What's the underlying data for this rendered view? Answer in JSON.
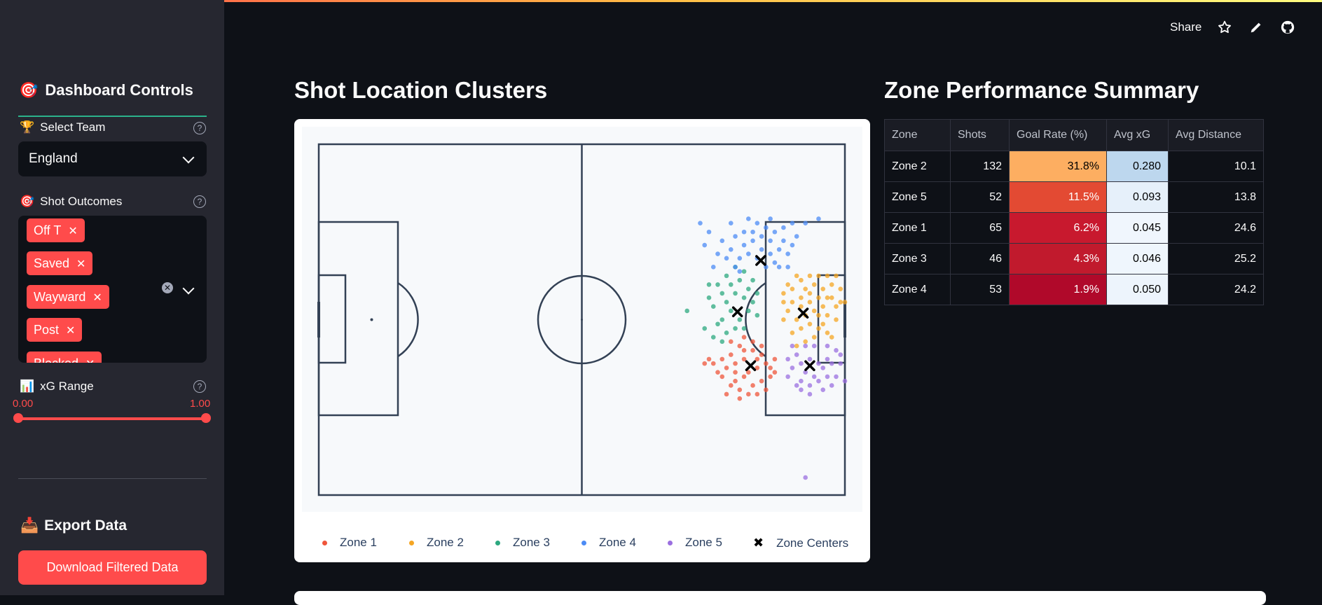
{
  "header": {
    "share_label": "Share",
    "icons": [
      "star-icon",
      "pencil-icon",
      "github-icon"
    ]
  },
  "sidebar": {
    "title_icon": "🎯",
    "title": "Dashboard Controls",
    "team": {
      "icon": "🏆",
      "label": "Select Team",
      "value": "England"
    },
    "outcomes": {
      "icon": "🎯",
      "label": "Shot Outcomes",
      "tags": [
        "Off T",
        "Saved",
        "Wayward",
        "Post",
        "Blocked"
      ]
    },
    "xg": {
      "icon": "📊",
      "label": "xG Range",
      "min": "0.00",
      "max": "1.00"
    },
    "export": {
      "icon": "📥",
      "title": "Export Data",
      "button": "Download Filtered Data"
    }
  },
  "main": {
    "chart_title": "Shot Location Clusters",
    "table_title": "Zone Performance Summary"
  },
  "colors": {
    "zone1": "#ef553b",
    "zone2": "#f5a623",
    "zone3": "#2ca87f",
    "zone4": "#4c8bf5",
    "zone5": "#9b6fe0",
    "accent": "#ff4b4b"
  },
  "chart_data": {
    "type": "scatter",
    "xlim": [
      0,
      120
    ],
    "ylim": [
      0,
      80
    ],
    "legend": [
      "Zone 1",
      "Zone 2",
      "Zone 3",
      "Zone 4",
      "Zone 5",
      "Zone Centers"
    ],
    "centers": [
      {
        "zone": "Zone 1",
        "x": 98.5,
        "y": 29.5
      },
      {
        "zone": "Zone 2",
        "x": 110.5,
        "y": 41.5
      },
      {
        "zone": "Zone 3",
        "x": 95.5,
        "y": 41.8
      },
      {
        "zone": "Zone 4",
        "x": 100.8,
        "y": 53.5
      },
      {
        "zone": "Zone 5",
        "x": 112.0,
        "y": 29.5
      }
    ],
    "series": [
      {
        "name": "Zone 1",
        "points": [
          [
            96,
            34
          ],
          [
            94,
            32
          ],
          [
            97,
            31
          ],
          [
            99,
            33
          ],
          [
            101,
            32
          ],
          [
            95,
            30
          ],
          [
            93,
            29
          ],
          [
            98,
            28
          ],
          [
            100,
            29
          ],
          [
            102,
            30
          ],
          [
            97,
            27
          ],
          [
            95,
            26
          ],
          [
            92,
            27
          ],
          [
            90,
            30
          ],
          [
            94,
            25
          ],
          [
            96,
            24
          ],
          [
            99,
            25
          ],
          [
            101,
            26
          ],
          [
            103,
            27
          ],
          [
            103,
            29
          ],
          [
            91,
            28
          ],
          [
            89,
            31
          ],
          [
            98,
            23
          ],
          [
            100,
            23
          ],
          [
            93,
            23
          ],
          [
            104,
            31
          ],
          [
            96,
            22
          ],
          [
            99,
            35
          ],
          [
            97,
            36
          ],
          [
            94,
            35
          ],
          [
            88,
            30
          ],
          [
            101,
            34
          ],
          [
            102,
            24
          ],
          [
            95,
            28
          ],
          [
            92,
            31
          ],
          [
            100,
            31
          ],
          [
            104,
            28
          ],
          [
            97,
            33
          ]
        ]
      },
      {
        "name": "Zone 2",
        "points": [
          [
            108,
            44
          ],
          [
            110,
            43
          ],
          [
            112,
            44
          ],
          [
            111,
            41
          ],
          [
            109,
            40
          ],
          [
            113,
            42
          ],
          [
            114,
            45
          ],
          [
            115,
            43
          ],
          [
            116,
            41
          ],
          [
            112,
            39
          ],
          [
            110,
            38
          ],
          [
            108,
            37
          ],
          [
            107,
            42
          ],
          [
            111,
            47
          ],
          [
            113,
            48
          ],
          [
            115,
            47
          ],
          [
            117,
            45
          ],
          [
            118,
            43
          ],
          [
            117,
            48
          ],
          [
            116,
            50
          ],
          [
            114,
            50
          ],
          [
            112,
            50
          ],
          [
            110,
            49
          ],
          [
            108,
            47
          ],
          [
            106,
            44
          ],
          [
            106,
            40
          ],
          [
            114,
            38
          ],
          [
            116,
            37
          ],
          [
            118,
            40
          ],
          [
            119,
            44
          ],
          [
            113,
            36
          ],
          [
            111,
            35
          ],
          [
            109,
            34
          ],
          [
            117,
            36
          ],
          [
            119,
            47
          ],
          [
            115,
            39
          ],
          [
            110,
            45
          ],
          [
            112,
            46
          ],
          [
            107,
            48
          ],
          [
            109,
            50
          ],
          [
            118,
            50
          ],
          [
            116,
            45
          ],
          [
            114,
            41
          ],
          [
            120,
            44
          ],
          [
            106,
            46
          ]
        ]
      },
      {
        "name": "Zone 3",
        "points": [
          [
            93,
            44
          ],
          [
            95,
            46
          ],
          [
            97,
            45
          ],
          [
            94,
            42
          ],
          [
            92,
            40
          ],
          [
            96,
            40
          ],
          [
            98,
            42
          ],
          [
            95,
            38
          ],
          [
            93,
            37
          ],
          [
            91,
            39
          ],
          [
            97,
            38
          ],
          [
            99,
            44
          ],
          [
            92,
            46
          ],
          [
            90,
            43
          ],
          [
            94,
            48
          ],
          [
            96,
            49
          ],
          [
            98,
            47
          ],
          [
            91,
            48
          ],
          [
            89,
            45
          ],
          [
            100,
            46
          ],
          [
            93,
            50
          ],
          [
            88,
            38
          ],
          [
            90,
            36
          ],
          [
            84,
            42
          ],
          [
            97,
            51
          ],
          [
            95,
            52
          ],
          [
            99,
            49
          ],
          [
            89,
            48
          ],
          [
            92,
            35
          ],
          [
            100,
            41
          ]
        ]
      },
      {
        "name": "Zone 4",
        "points": [
          [
            98,
            55
          ],
          [
            100,
            54
          ],
          [
            102,
            52
          ],
          [
            101,
            56
          ],
          [
            99,
            58
          ],
          [
            97,
            57
          ],
          [
            96,
            54
          ],
          [
            103,
            55
          ],
          [
            104,
            53
          ],
          [
            105,
            56
          ],
          [
            103,
            58
          ],
          [
            101,
            59
          ],
          [
            99,
            60
          ],
          [
            97,
            60
          ],
          [
            95,
            59
          ],
          [
            94,
            56
          ],
          [
            93,
            54
          ],
          [
            95,
            52
          ],
          [
            104,
            60
          ],
          [
            106,
            58
          ],
          [
            107,
            55
          ],
          [
            105,
            52
          ],
          [
            102,
            61
          ],
          [
            100,
            62
          ],
          [
            92,
            58
          ],
          [
            91,
            55
          ],
          [
            89,
            60
          ],
          [
            90,
            52
          ],
          [
            88,
            57
          ],
          [
            87,
            62
          ],
          [
            103,
            63
          ],
          [
            106,
            61
          ],
          [
            108,
            57
          ],
          [
            109,
            59
          ],
          [
            111,
            62
          ],
          [
            94,
            62
          ],
          [
            98,
            63
          ],
          [
            107,
            52
          ],
          [
            96,
            51
          ],
          [
            114,
            63
          ],
          [
            108,
            62
          ]
        ]
      },
      {
        "name": "Zone 5",
        "points": [
          [
            110,
            30
          ],
          [
            112,
            31
          ],
          [
            114,
            30
          ],
          [
            111,
            28
          ],
          [
            113,
            27
          ],
          [
            115,
            29
          ],
          [
            116,
            31
          ],
          [
            109,
            32
          ],
          [
            108,
            29
          ],
          [
            110,
            26
          ],
          [
            112,
            25
          ],
          [
            114,
            26
          ],
          [
            116,
            27
          ],
          [
            117,
            30
          ],
          [
            118,
            33
          ],
          [
            116,
            34
          ],
          [
            113,
            34
          ],
          [
            111,
            34
          ],
          [
            109,
            25
          ],
          [
            107,
            27
          ],
          [
            107,
            31
          ],
          [
            118,
            27
          ],
          [
            119,
            30
          ],
          [
            115,
            24
          ],
          [
            110,
            24
          ],
          [
            112,
            23
          ],
          [
            120,
            26
          ],
          [
            117,
            25
          ],
          [
            119,
            32
          ],
          [
            108,
            34
          ],
          [
            111,
            4
          ]
        ]
      }
    ]
  },
  "zone_table": {
    "columns": [
      "Zone",
      "Shots",
      "Goal Rate (%)",
      "Avg xG",
      "Avg Distance"
    ],
    "rows": [
      [
        "Zone 2",
        "132",
        "31.8%",
        "0.280",
        "10.1"
      ],
      [
        "Zone 5",
        "52",
        "11.5%",
        "0.093",
        "13.8"
      ],
      [
        "Zone 1",
        "65",
        "6.2%",
        "0.045",
        "24.6"
      ],
      [
        "Zone 3",
        "46",
        "4.3%",
        "0.046",
        "25.2"
      ],
      [
        "Zone 4",
        "53",
        "1.9%",
        "0.050",
        "24.2"
      ]
    ],
    "goal_rate_colors": [
      "#fdae61",
      "#e34a33",
      "#c8192e",
      "#c11a2d",
      "#b0092a"
    ],
    "avg_xg_colors": [
      "#bdd7ee",
      "#e6f0fa",
      "#f0f6fd",
      "#eff6fd",
      "#edf4fc"
    ]
  }
}
